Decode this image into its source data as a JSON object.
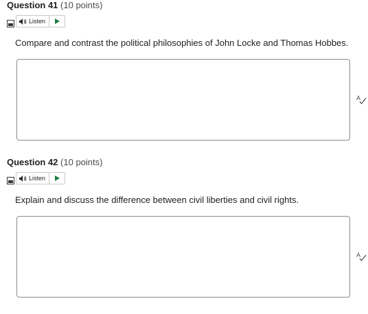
{
  "questions": [
    {
      "number_label": "Question 41",
      "points_label": "(10 points)",
      "listen_label": "Listen",
      "prompt": "Compare and contrast the political philosophies of John Locke and Thomas Hobbes.",
      "answer_value": ""
    },
    {
      "number_label": "Question 42",
      "points_label": "(10 points)",
      "listen_label": "Listen",
      "prompt": "Explain and discuss the difference between civil liberties and civil rights.",
      "answer_value": ""
    }
  ],
  "icons": {
    "menu": "menu-icon",
    "speaker": "speaker-icon",
    "play": "play-icon",
    "spellcheck": "spellcheck-icon"
  },
  "colors": {
    "play_accent": "#1a7a3d",
    "box_border": "#868c8f"
  }
}
